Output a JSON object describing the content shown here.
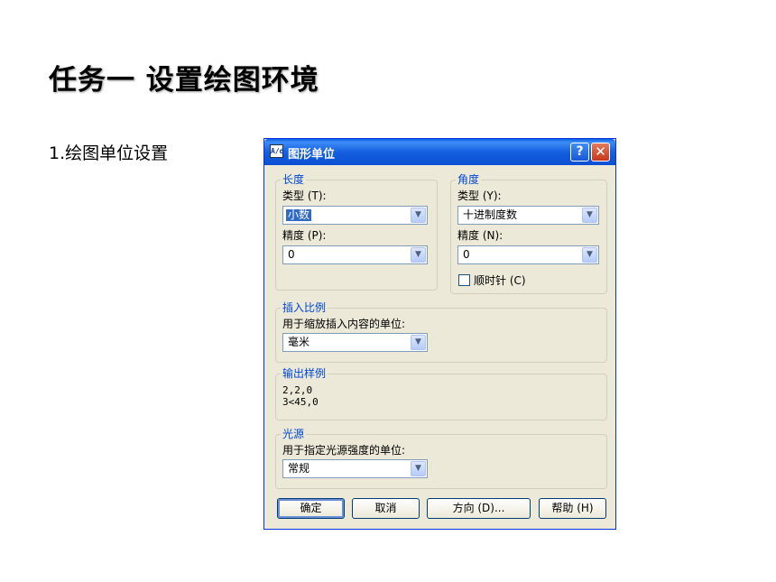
{
  "slide": {
    "title": "任务一 设置绘图环境",
    "bullet": "1.绘图单位设置"
  },
  "dialog": {
    "title": "图形单位",
    "app_icon_text": "A/d",
    "help_glyph": "?",
    "close_glyph": "✕",
    "length": {
      "legend": "长度",
      "type_label": "类型 (T):",
      "type_value": "小数",
      "precision_label": "精度 (P):",
      "precision_value": "0"
    },
    "angle": {
      "legend": "角度",
      "type_label": "类型 (Y):",
      "type_value": "十进制度数",
      "precision_label": "精度 (N):",
      "precision_value": "0",
      "clockwise_label": "顺时针 (C)",
      "clockwise_checked": false
    },
    "insert_scale": {
      "legend": "插入比例",
      "label": "用于缩放插入内容的单位:",
      "value": "毫米"
    },
    "output_sample": {
      "legend": "输出样例",
      "line1": "2,2,0",
      "line2": "3<45,0"
    },
    "lighting": {
      "legend": "光源",
      "label": "用于指定光源强度的单位:",
      "value": "常规"
    },
    "buttons": {
      "ok": "确定",
      "cancel": "取消",
      "direction": "方向 (D)...",
      "help": "帮助 (H)"
    },
    "dropdown_glyph": "▼"
  }
}
